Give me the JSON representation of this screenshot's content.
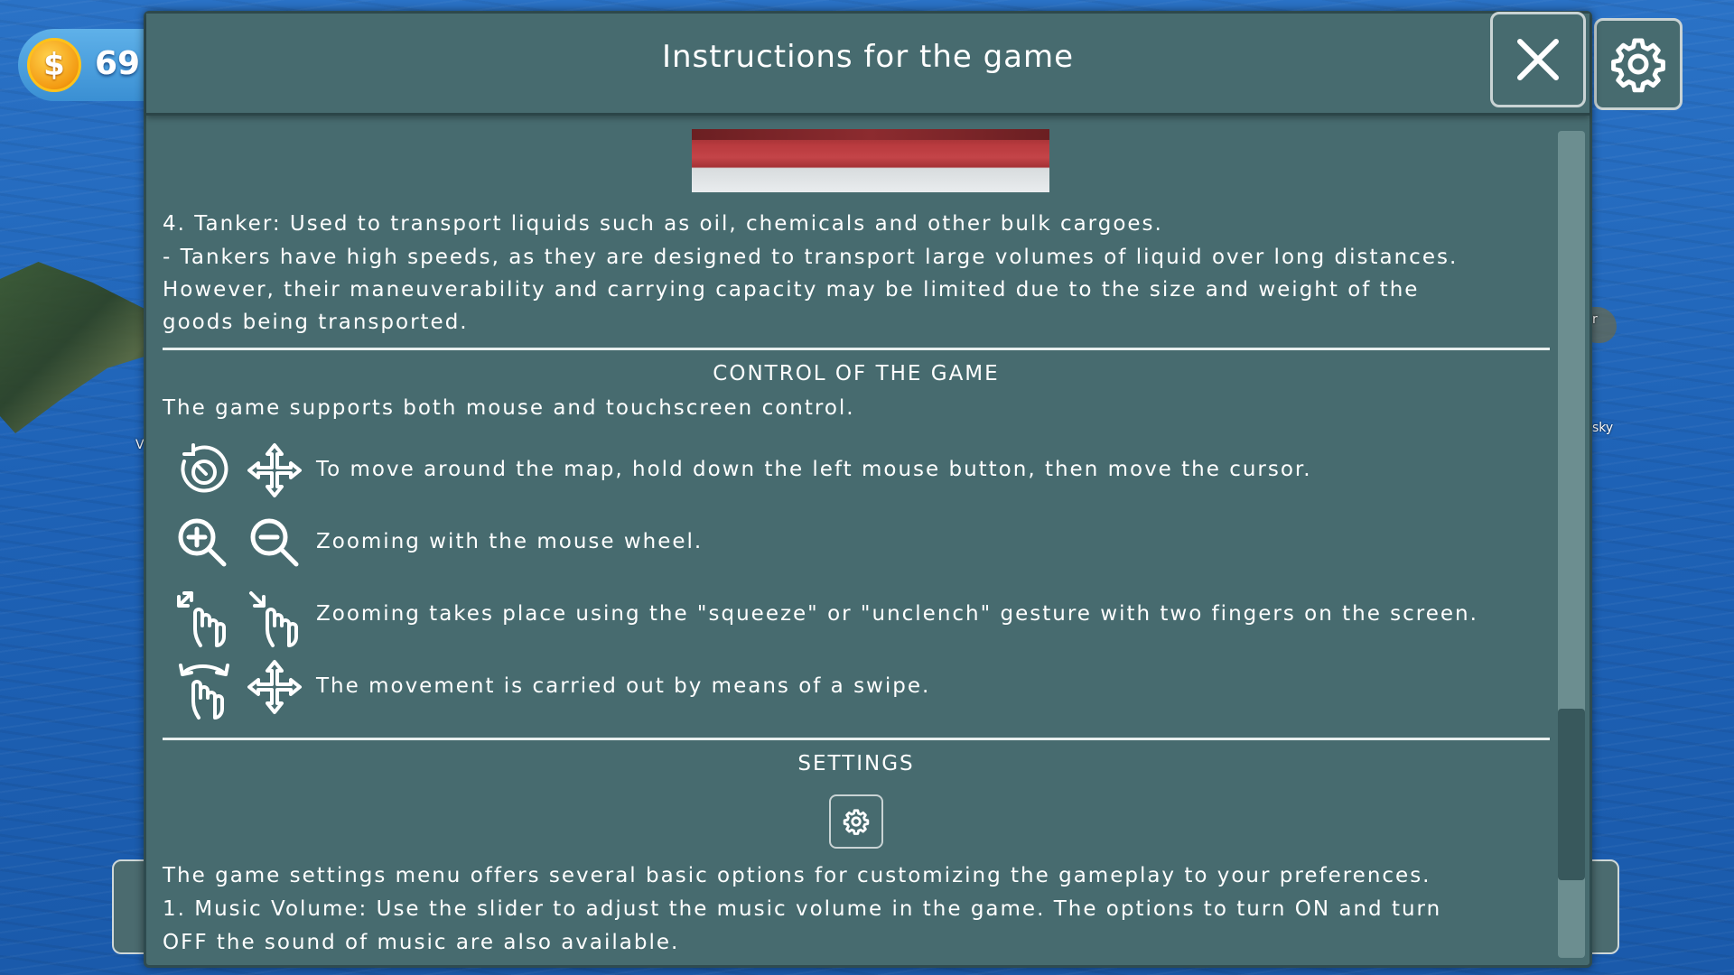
{
  "hud": {
    "coins": "69"
  },
  "map_labels": [
    "V",
    "r",
    "sky"
  ],
  "dialog": {
    "title": "Instructions for the game",
    "close_icon": "close-icon",
    "settings_icon": "gear-icon"
  },
  "content": {
    "tanker_title": "4. Tanker: Used to transport liquids such as oil, chemicals and other bulk cargoes.",
    "tanker_lines": [
      "- Tankers have high speeds, as they are designed to transport large volumes of liquid over long distances.",
      "However, their maneuverability and carrying capacity may be limited due to the size and weight of the",
      "goods being transported."
    ],
    "control_heading": "CONTROL OF THE GAME",
    "control_intro": "The game supports both mouse and touchscreen control.",
    "controls": [
      {
        "icons": [
          "rotate-hold-icon",
          "move-arrows-icon"
        ],
        "text": "To move around the map, hold down the left mouse button, then move the cursor."
      },
      {
        "icons": [
          "zoom-in-icon",
          "zoom-out-icon"
        ],
        "text": "Zooming with the mouse wheel."
      },
      {
        "icons": [
          "pinch-out-icon",
          "pinch-in-icon"
        ],
        "text": "Zooming takes place using the \"squeeze\" or \"unclench\" gesture with two fingers on the screen."
      },
      {
        "icons": [
          "swipe-hand-icon",
          "move-arrows-icon"
        ],
        "text": "The movement is carried out by means of a swipe."
      }
    ],
    "settings_heading": "SETTINGS",
    "settings_lines": [
      "The game settings menu offers several basic options for customizing the gameplay to your preferences.",
      "1. Music Volume: Use the slider to adjust the music volume in the game. The options to turn ON and turn",
      "OFF the sound of music are also available."
    ]
  },
  "colors": {
    "panel": "#476b6f",
    "ocean": "#1e63b8",
    "coin": "#f39a12"
  }
}
